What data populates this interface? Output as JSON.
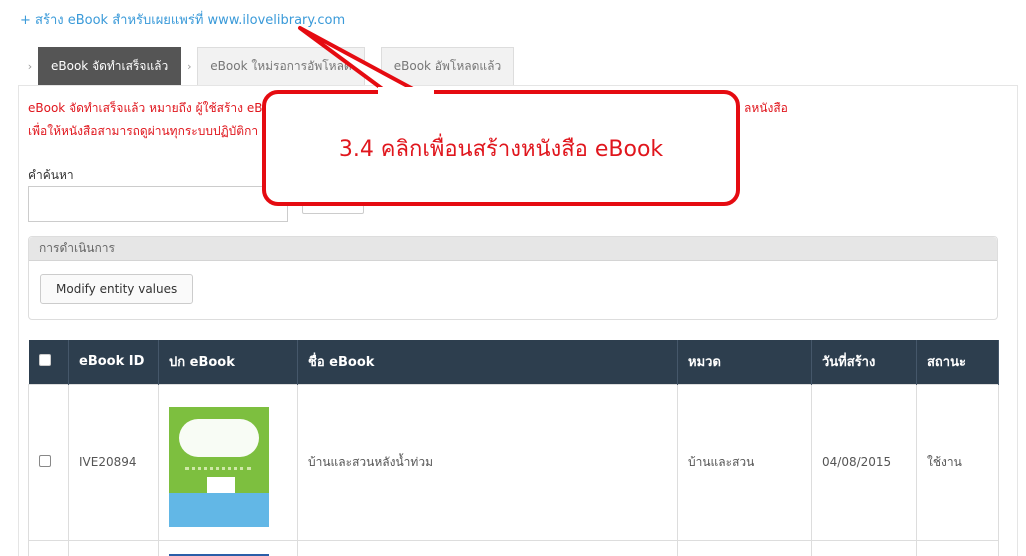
{
  "create_link": "+ สร้าง eBook สำหรับเผยแพร่ที่ www.ilovelibrary.com",
  "tabs": [
    {
      "label": "eBook จัดทำเสร็จแล้ว",
      "active": true
    },
    {
      "label": "eBook ใหม่รอการอัพโหลด",
      "active": false
    },
    {
      "label": "eBook อัพโหลดแล้ว",
      "active": false
    }
  ],
  "description": {
    "line1_start": "eBook จัดทำเสร็จแล้ว หมายถึง ผู้ใช้สร้าง eB",
    "line1_end": "ลหนังสือ",
    "line2": "เพื่อให้หนังสือสามารถดูผ่านทุกระบบปฏิบัติกา"
  },
  "search": {
    "label": "คำค้นหา",
    "value": ""
  },
  "operations": {
    "header": "การดำเนินการ",
    "modify_button": "Modify entity values"
  },
  "table": {
    "headers": [
      "eBook ID",
      "ปก eBook",
      "ชื่อ eBook",
      "หมวด",
      "วันที่สร้าง",
      "สถานะ"
    ],
    "rows": [
      {
        "id": "IVE20894",
        "title": "บ้านและสวนหลังน้ำท่วม",
        "category": "บ้านและสวน",
        "created": "04/08/2015",
        "status": "ใช้งาน"
      }
    ]
  },
  "callout": {
    "text": "3.4 คลิกเพื่อนสร้างหนังสือ eBook"
  },
  "colors": {
    "accent_red": "#e0161d",
    "link_blue": "#3a9ad9",
    "table_header": "#2d3e4e",
    "tab_active": "#555555"
  }
}
